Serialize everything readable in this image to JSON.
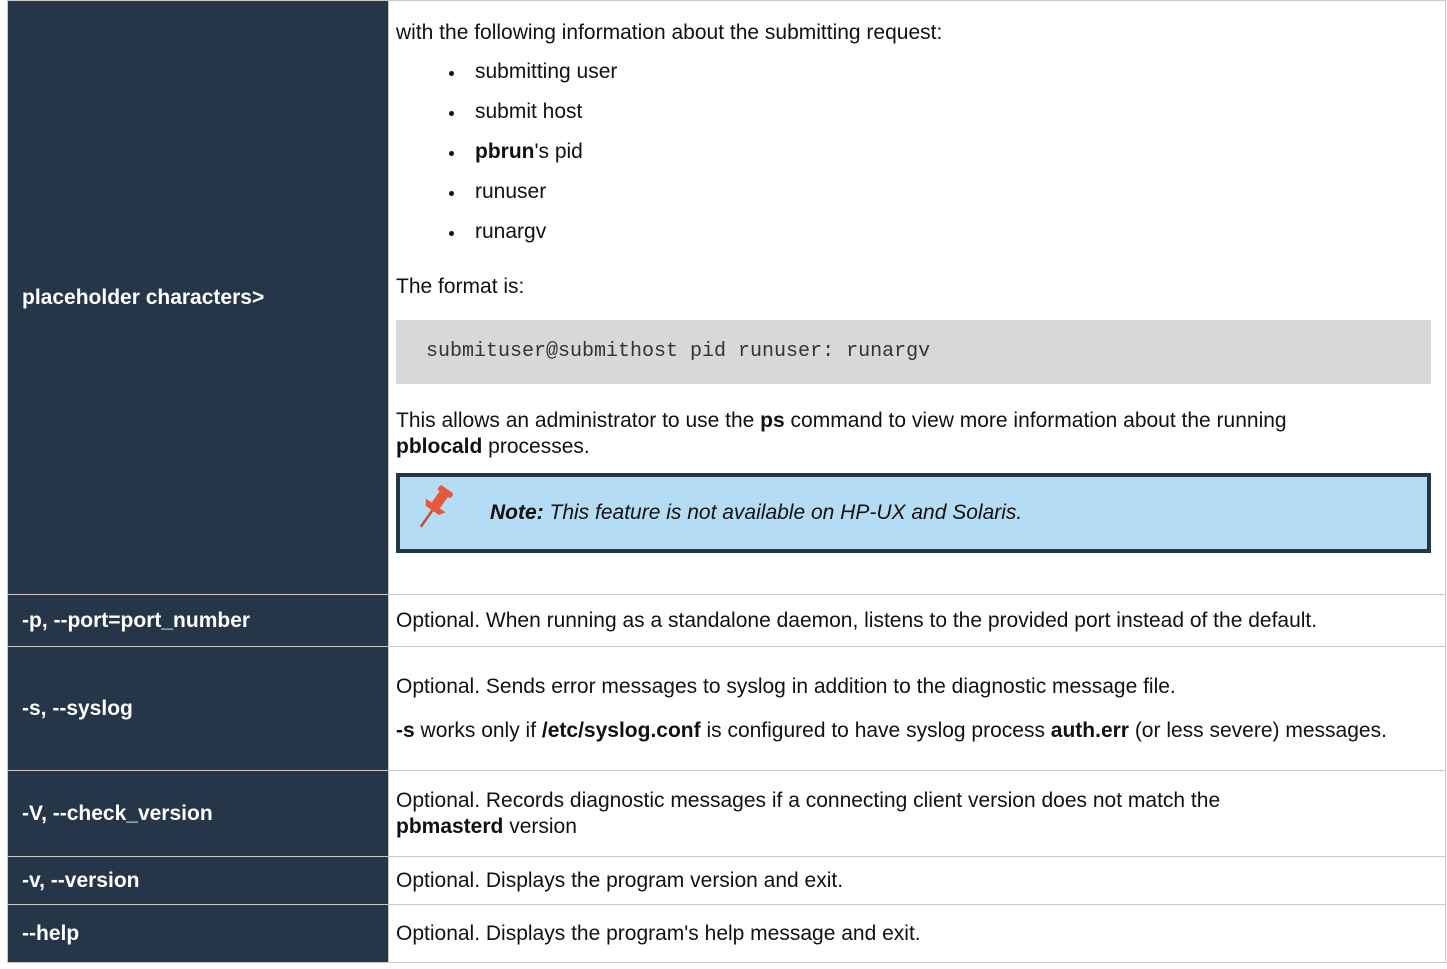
{
  "rows": {
    "placeholder": {
      "key": "placeholder characters>",
      "intro": "with the following information about the submitting request:",
      "bullets": [
        "submitting user",
        "submit host",
        "pbrun",
        "'s pid",
        "runuser",
        "runargv"
      ],
      "format_label": "The format is:",
      "code": "submituser@submithost pid runuser: runargv",
      "allows_1": "This allows an administrator to use the ",
      "allows_ps": "ps",
      "allows_2": " command to view more information about the running",
      "allows_pblocald": "pblocald",
      "allows_3": " processes.",
      "note_label": "Note:",
      "note_text": " This feature is not available on HP-UX and Solaris.",
      "note_icon": "pushpin-icon",
      "note_icon_color": "#e8573a"
    },
    "port": {
      "key": "-p, --port=port_number",
      "desc": "Optional. When running as a standalone daemon, listens to the provided port instead of the default."
    },
    "syslog": {
      "key": "-s, --syslog",
      "desc1": "Optional. Sends error messages to syslog in addition to the diagnostic message file.",
      "s_flag": "-s",
      "works": " works only if ",
      "conf": "/etc/syslog.conf",
      "configured": " is configured to have syslog process ",
      "autherr": "auth.err",
      "rest": " (or less severe) messages."
    },
    "check_version": {
      "key": "-V, --check_version",
      "desc_1": "Optional. Records diagnostic messages if a connecting client version does not match the",
      "pbmasterd": "pbmasterd",
      "desc_2": " version"
    },
    "version": {
      "key": "-v, --version",
      "desc": "Optional. Displays the program version and exit."
    },
    "help": {
      "key": "--help",
      "desc": "Optional. Displays the program's help message and exit."
    }
  },
  "colors": {
    "key_background": "#253648",
    "code_background": "#d8d8d8",
    "note_background": "#b4dcf5"
  }
}
